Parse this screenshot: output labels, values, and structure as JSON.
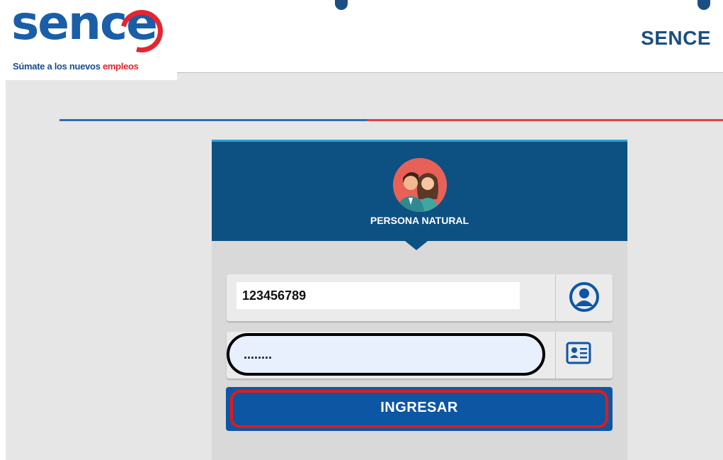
{
  "header": {
    "logo_text": "sence",
    "logo_tagline": "Súmate a los nuevos",
    "logo_tagline_accent": "empleos",
    "brand": "SENCE"
  },
  "login": {
    "profile_title": "PERSONA NATURAL",
    "username_value": "123456789",
    "password_value": "........",
    "submit_label": "INGRESAR"
  },
  "icons": {
    "user": "user-circle-icon",
    "id_card": "id-card-icon"
  },
  "colors": {
    "primary": "#0d5183",
    "button": "#0d56a3",
    "accent_red": "#e0404a",
    "accent_blue": "#2f6db5"
  }
}
